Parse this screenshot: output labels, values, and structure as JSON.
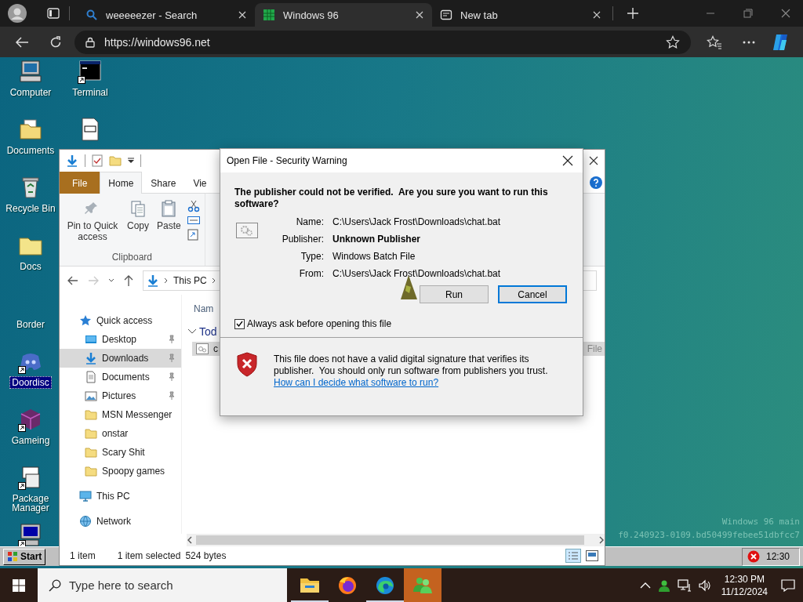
{
  "browser": {
    "tabs": [
      {
        "title": "weeeeezer - Search",
        "kind": "search",
        "selected": false
      },
      {
        "title": "Windows 96",
        "kind": "site",
        "selected": true
      },
      {
        "title": "New tab",
        "kind": "newtab",
        "selected": false
      }
    ],
    "url": "https://windows96.net"
  },
  "desktop": {
    "icons": [
      {
        "label": "Computer",
        "kind": "computer",
        "shortcut": false,
        "selected": false
      },
      {
        "label": "Documents",
        "kind": "docs-folder",
        "shortcut": false,
        "selected": false
      },
      {
        "label": "Recycle Bin",
        "kind": "recycle",
        "shortcut": false,
        "selected": false
      },
      {
        "label": "Docs",
        "kind": "folder",
        "shortcut": false,
        "selected": false
      },
      {
        "label": "Border",
        "kind": "blank",
        "shortcut": false,
        "selected": false
      },
      {
        "label": "Doordisc",
        "kind": "discord",
        "shortcut": true,
        "selected": true
      },
      {
        "label": "Gameing",
        "kind": "cube",
        "shortcut": true,
        "selected": false
      },
      {
        "label": "Package Manager",
        "kind": "package",
        "shortcut": true,
        "selected": false
      },
      {
        "kind": "monitor",
        "shortcut": true,
        "selected": false
      },
      {
        "label": "Terminal",
        "kind": "terminal",
        "shortcut": true,
        "selected": false
      },
      {
        "kind": "document",
        "shortcut": false,
        "selected": false
      }
    ],
    "start_button": "Start",
    "tray_time": "12:30",
    "build_info": [
      "Windows 96 main",
      "f0.240923-0109.bd50499febee51dbfcc7"
    ]
  },
  "explorer": {
    "ribbon_tabs": [
      {
        "label": "File",
        "kind": "file",
        "selected": false
      },
      {
        "label": "Home",
        "kind": "tab",
        "selected": true
      },
      {
        "label": "Share",
        "kind": "tab",
        "selected": false
      },
      {
        "label": "Vie",
        "kind": "tab",
        "selected": false
      }
    ],
    "ribbon_buttons": [
      {
        "label": "Pin to Quick access",
        "kind": "pin"
      },
      {
        "label": "Copy",
        "kind": "copy"
      },
      {
        "label": "Paste",
        "kind": "paste"
      }
    ],
    "ribbon_group": "Clipboard",
    "path": [
      "This PC"
    ],
    "nav": [
      {
        "label": "Quick access",
        "kind": "star",
        "pinned": false,
        "selected": false,
        "children": [
          {
            "label": "Desktop",
            "kind": "desktop",
            "pinned": true,
            "selected": false
          },
          {
            "label": "Downloads",
            "kind": "downloads",
            "pinned": true,
            "selected": true
          },
          {
            "label": "Documents",
            "kind": "documents",
            "pinned": true,
            "selected": false
          },
          {
            "label": "Pictures",
            "kind": "pictures",
            "pinned": true,
            "selected": false
          },
          {
            "label": "MSN Messenger",
            "kind": "folder",
            "pinned": false,
            "selected": false
          },
          {
            "label": "onstar",
            "kind": "folder",
            "pinned": false,
            "selected": false
          },
          {
            "label": "Scary Shit",
            "kind": "folder",
            "pinned": false,
            "selected": false
          },
          {
            "label": "Spoopy games",
            "kind": "folder",
            "pinned": false,
            "selected": false
          }
        ]
      },
      {
        "label": "This PC",
        "kind": "pc",
        "pinned": false,
        "selected": false
      },
      {
        "label": "Network",
        "kind": "network",
        "pinned": false,
        "selected": false
      }
    ],
    "column_header": "Nam",
    "group": "Tod",
    "files": [
      {
        "name": "c",
        "type": "File",
        "selected": true
      }
    ],
    "status": [
      "1 item",
      "1 item selected",
      "524 bytes"
    ]
  },
  "dialog": {
    "title": "Open File - Security Warning",
    "heading": "The publisher could not be verified.  Are you sure you want to run this software?",
    "fields": [
      {
        "label": "Name:",
        "value": "C:\\Users\\Jack Frost\\Downloads\\chat.bat",
        "bold": false
      },
      {
        "label": "Publisher:",
        "value": "Unknown Publisher",
        "bold": true
      },
      {
        "label": "Type:",
        "value": "Windows Batch File",
        "bold": false
      },
      {
        "label": "From:",
        "value": "C:\\Users\\Jack Frost\\Downloads\\chat.bat",
        "bold": false
      }
    ],
    "buttons": [
      {
        "label": "Run",
        "focused": false
      },
      {
        "label": "Cancel",
        "focused": true
      }
    ],
    "checkbox": {
      "label": "Always ask before opening this file",
      "checked": true
    },
    "message": "This file does not have a valid digital signature that verifies its publisher.  You should only run software from publishers you trust.",
    "link": "How can I decide what software to run?"
  },
  "taskbar": {
    "search_placeholder": "Type here to search",
    "apps": [
      {
        "kind": "folder",
        "running": true,
        "flashing": false
      },
      {
        "kind": "firefox",
        "running": false,
        "flashing": false
      },
      {
        "kind": "edge",
        "running": true,
        "flashing": false
      },
      {
        "kind": "msn",
        "running": false,
        "flashing": true
      }
    ],
    "time": "12:30 PM",
    "date": "11/12/2024"
  }
}
